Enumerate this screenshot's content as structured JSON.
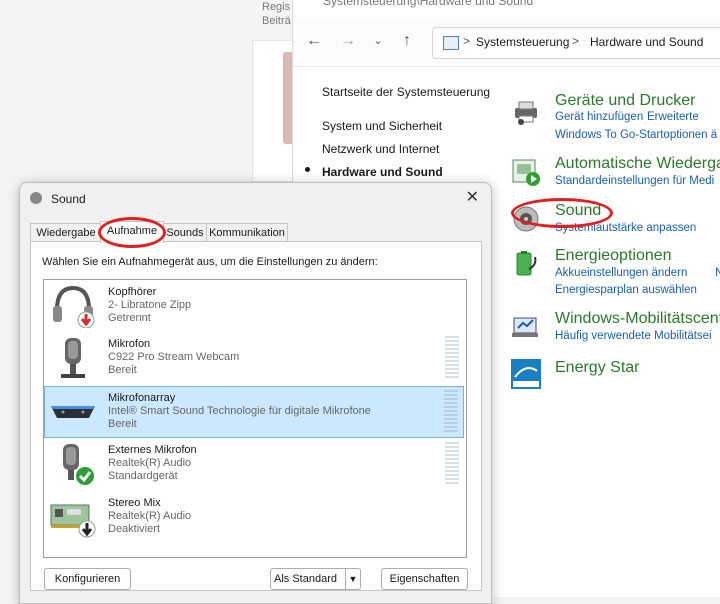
{
  "background_app": {
    "line1": "Regis",
    "line2": "Beiträ"
  },
  "control_panel": {
    "title": "Systemsteuerung\\Hardware und Sound",
    "address": {
      "crumb1": "Systemsteuerung",
      "sep": ">",
      "crumb2": "Hardware und Sound"
    },
    "sidebar": {
      "home": "Startseite der Systemsteuerung",
      "items": [
        "System und Sicherheit",
        "Netzwerk und Internet",
        "Hardware und Sound"
      ]
    },
    "categories": [
      {
        "title": "Geräte und Drucker",
        "links": [
          "Gerät hinzufügen",
          "Erweiterte",
          "Windows To Go-Startoptionen ä"
        ]
      },
      {
        "title": "Automatische Wiederga",
        "links": [
          "Standardeinstellungen für Medi"
        ]
      },
      {
        "title": "Sound",
        "links": [
          "Systemlautstärke anpassen"
        ]
      },
      {
        "title": "Energieoptionen",
        "links": [
          "Akkueinstellungen ändern",
          "N",
          "Energiesparplan auswählen"
        ]
      },
      {
        "title": "Windows-Mobilitätscent",
        "links": [
          "Häufig verwendete Mobilitätsei"
        ]
      },
      {
        "title": "Energy Star",
        "links": []
      }
    ]
  },
  "dialog": {
    "title": "Sound",
    "close": "✕",
    "tabs": [
      "Wiedergabe",
      "Aufnahme",
      "Sounds",
      "Kommunikation"
    ],
    "instruction": "Wählen Sie ein Aufnahmegerät aus, um die Einstellungen zu ändern:",
    "devices": [
      {
        "name": "Kopfhörer",
        "desc": "2- Libratone Zipp",
        "status": "Getrennt"
      },
      {
        "name": "Mikrofon",
        "desc": "C922 Pro Stream Webcam",
        "status": "Bereit"
      },
      {
        "name": "Mikrofonarray",
        "desc": "Intel® Smart Sound Technologie für digitale Mikrofone",
        "status": "Bereit"
      },
      {
        "name": "Externes Mikrofon",
        "desc": "Realtek(R) Audio",
        "status": "Standardgerät"
      },
      {
        "name": "Stereo Mix",
        "desc": "Realtek(R) Audio",
        "status": "Deaktiviert"
      }
    ],
    "buttons": {
      "configure": "Konfigurieren",
      "default": "Als Standard",
      "properties": "Eigenschaften"
    }
  },
  "colors": {
    "accent_green": "#2a7a2a",
    "link_blue": "#1a5fb4",
    "annotation_red": "#e02020",
    "selection": "#cce8ff"
  }
}
